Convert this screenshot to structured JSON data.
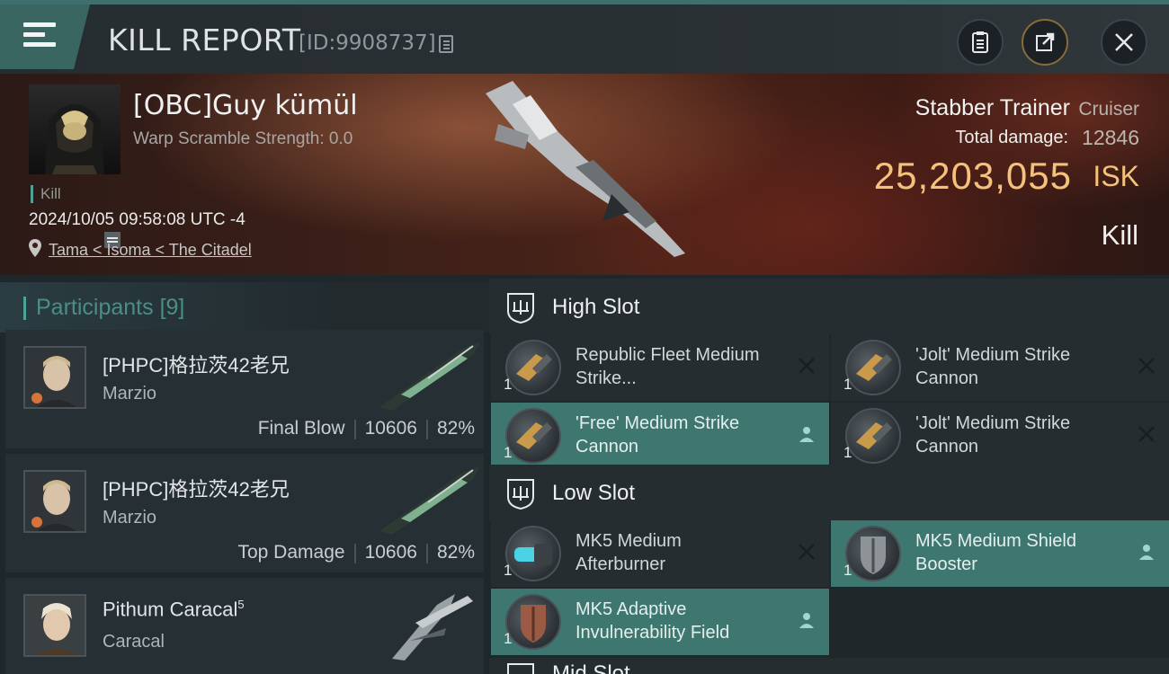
{
  "header": {
    "title": "KILL REPORT",
    "report_id": "[ID:9908737]"
  },
  "victim": {
    "name": "[OBC]Guy kümül",
    "warp_scramble": "Warp Scramble Strength: 0.0",
    "type_tag": "Kill",
    "datetime": "2024/10/05 09:58:08 UTC -4",
    "location": "Tama < Isoma < The Citadel",
    "ship_name": "Stabber Trainer",
    "ship_class": "Cruiser",
    "total_damage_label": "Total damage:",
    "total_damage": "12846",
    "isk_value": "25,203,055",
    "isk_unit": "ISK",
    "result": "Kill"
  },
  "participants": {
    "title": "Participants",
    "count": "[9]",
    "rows": [
      {
        "name": "[PHPC]格拉茨42老兄",
        "ship": "Marzio",
        "role": "Final Blow",
        "damage": "10606",
        "percent": "82%"
      },
      {
        "name": "[PHPC]格拉茨42老兄",
        "ship": "Marzio",
        "role": "Top Damage",
        "damage": "10606",
        "percent": "82%"
      },
      {
        "name": "Pithum Caracal",
        "superscript": "5",
        "ship": "Caracal"
      }
    ]
  },
  "fitting": {
    "high_slot": {
      "title": "High Slot",
      "modules": [
        {
          "name": "Republic Fleet Medium Strike...",
          "qty": "1",
          "status": "destroyed"
        },
        {
          "name": "'Jolt' Medium Strike Cannon",
          "qty": "1",
          "status": "destroyed"
        },
        {
          "name": "'Free' Medium Strike Cannon",
          "qty": "1",
          "status": "dropped"
        },
        {
          "name": "'Jolt' Medium Strike Cannon",
          "qty": "1",
          "status": "destroyed"
        }
      ]
    },
    "low_slot": {
      "title": "Low Slot",
      "modules": [
        {
          "name": "MK5 Medium Afterburner",
          "qty": "1",
          "status": "destroyed"
        },
        {
          "name": "MK5 Medium Shield Booster",
          "qty": "1",
          "status": "dropped"
        },
        {
          "name": "MK5 Adaptive Invulnerability Field",
          "qty": "1",
          "status": "dropped"
        }
      ]
    },
    "mid_slot": {
      "title": "Mid Slot"
    }
  },
  "colors": {
    "accent_teal": "#4fa29a",
    "dropped_bg": "#3e7670",
    "isk_gold": "#f4c27a"
  },
  "icons": [
    "menu-icon",
    "copy-icon",
    "clipboard-icon",
    "share-icon",
    "close-icon",
    "pin-icon",
    "slot-icon",
    "destroyed-x-icon",
    "dropped-person-icon"
  ]
}
